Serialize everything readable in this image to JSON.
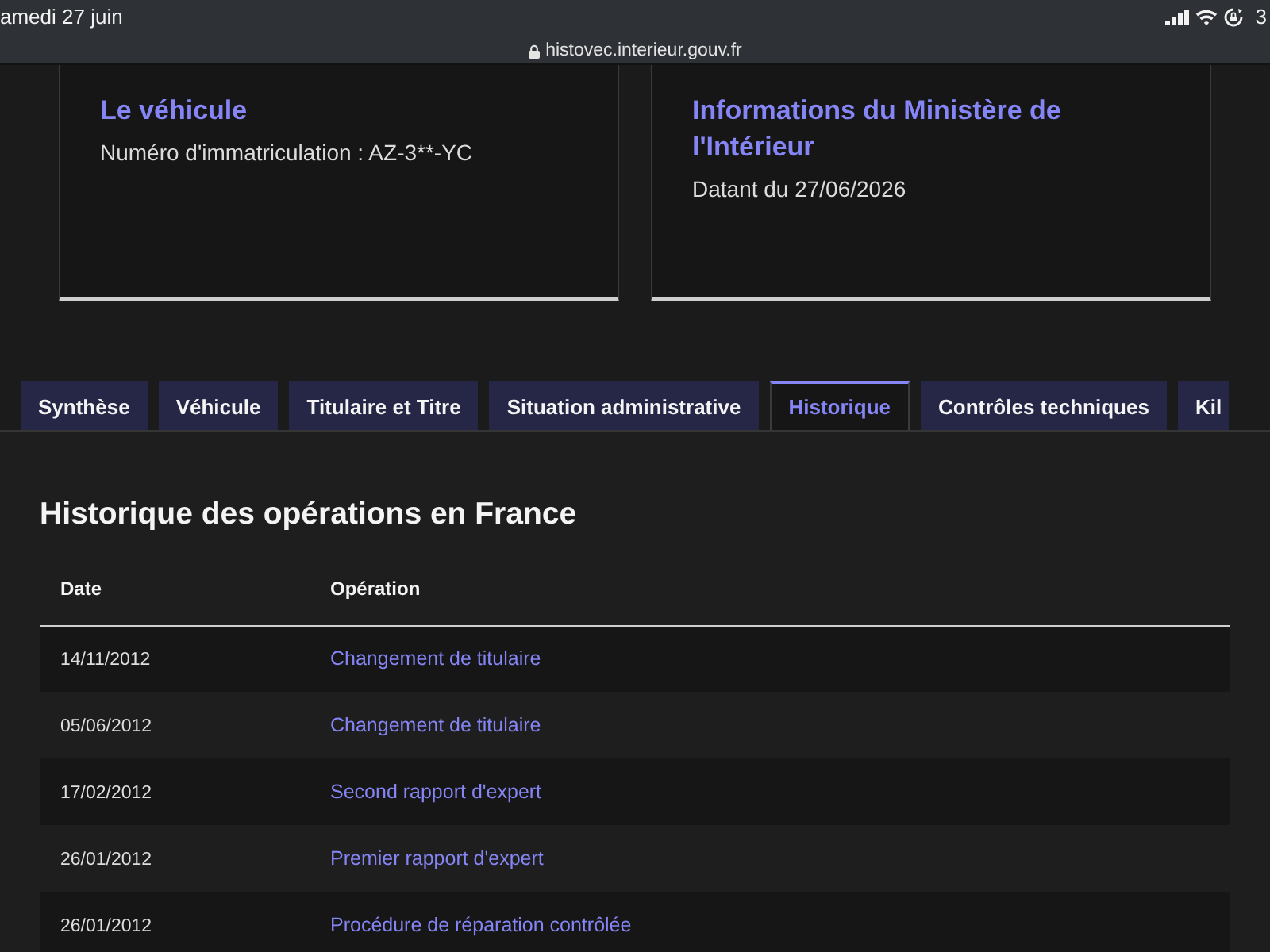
{
  "status_bar": {
    "date": "amedi 27 juin",
    "time": "3",
    "url": "histovec.interieur.gouv.fr"
  },
  "cards": [
    {
      "title": "Le véhicule",
      "text": "Numéro d'immatriculation : AZ-3**-YC"
    },
    {
      "title": "Informations du Ministère de l'Intérieur",
      "text": "Datant du 27/06/2026"
    }
  ],
  "tabs": [
    {
      "label": "Synthèse",
      "selected": false
    },
    {
      "label": "Véhicule",
      "selected": false
    },
    {
      "label": "Titulaire et Titre",
      "selected": false
    },
    {
      "label": "Situation administrative",
      "selected": false
    },
    {
      "label": "Historique",
      "selected": true
    },
    {
      "label": "Contrôles techniques",
      "selected": false
    },
    {
      "label": "Kil",
      "selected": false
    }
  ],
  "section": {
    "title": "Historique des opérations en France",
    "table": {
      "columns": [
        "Date",
        "Opération"
      ],
      "rows": [
        {
          "date": "14/11/2012",
          "operation": "Changement de titulaire"
        },
        {
          "date": "05/06/2012",
          "operation": "Changement de titulaire"
        },
        {
          "date": "17/02/2012",
          "operation": "Second rapport d'expert"
        },
        {
          "date": "26/01/2012",
          "operation": "Premier rapport d'expert"
        },
        {
          "date": "26/01/2012",
          "operation": "Procédure de réparation contrôlée"
        }
      ]
    }
  }
}
